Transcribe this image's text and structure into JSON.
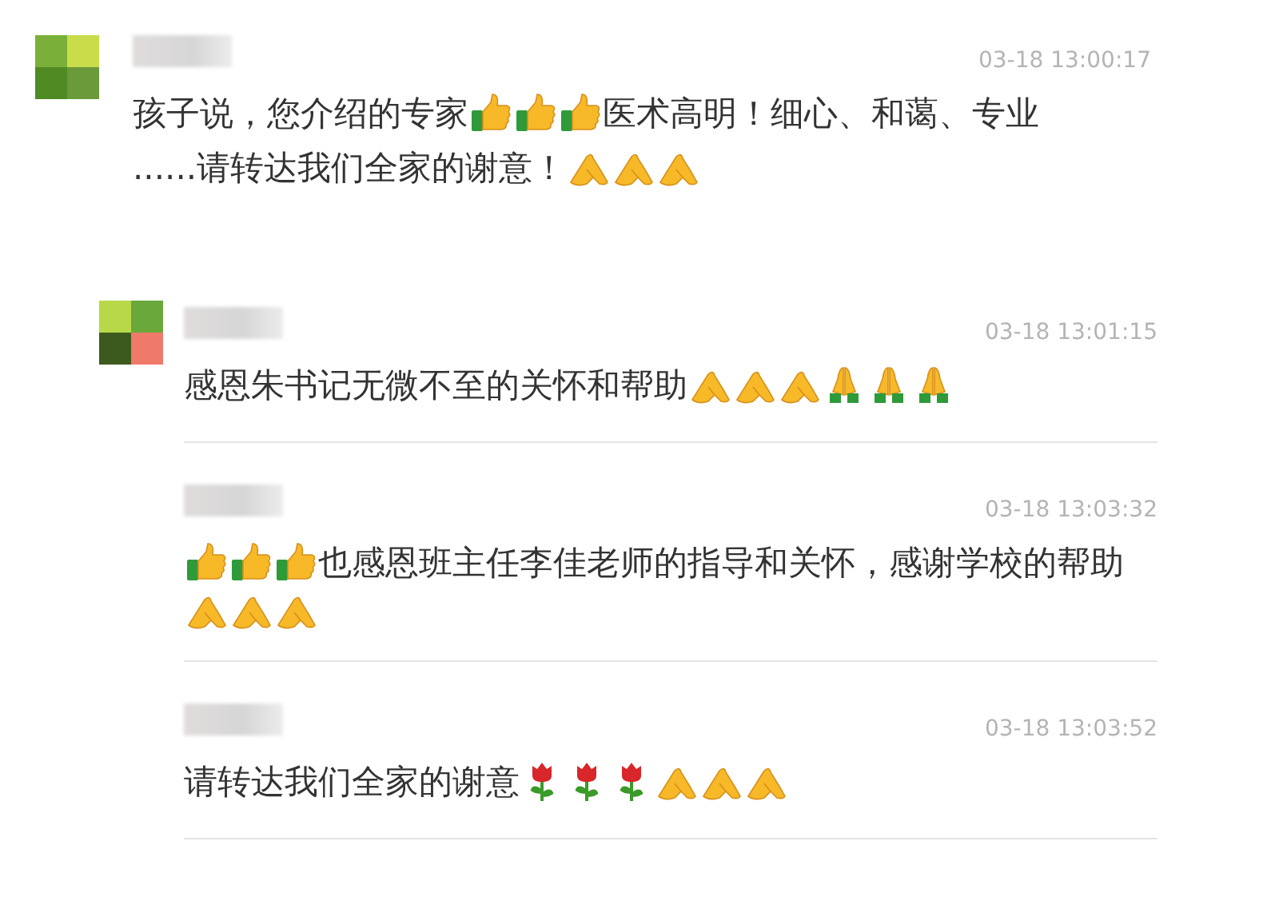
{
  "comment": {
    "time": "03-18 13:00:17",
    "has_avatar": true,
    "content": [
      {
        "kind": "text",
        "text": "孩子说，您介绍的专家"
      },
      {
        "kind": "thumbs-up"
      },
      {
        "kind": "thumbs-up"
      },
      {
        "kind": "thumbs-up"
      },
      {
        "kind": "text",
        "text": "医术高明！细心、和蔼、专业"
      },
      {
        "kind": "text",
        "text": "......请转达我们全家的谢意！"
      },
      {
        "kind": "palms"
      },
      {
        "kind": "palms"
      },
      {
        "kind": "palms"
      }
    ]
  },
  "replies": [
    {
      "time": "03-18 13:01:15",
      "has_avatar": true,
      "content": [
        {
          "kind": "text",
          "text": "感恩朱书记无微不至的关怀和帮助"
        },
        {
          "kind": "palms"
        },
        {
          "kind": "palms"
        },
        {
          "kind": "palms"
        },
        {
          "kind": "pray"
        },
        {
          "kind": "pray"
        },
        {
          "kind": "pray"
        }
      ]
    },
    {
      "time": "03-18 13:03:32",
      "has_avatar": false,
      "content": [
        {
          "kind": "thumbs-up"
        },
        {
          "kind": "thumbs-up"
        },
        {
          "kind": "thumbs-up"
        },
        {
          "kind": "text",
          "text": "也感恩班主任李佳老师的指导和关怀，感谢学校的帮"
        },
        {
          "kind": "text",
          "text": "助"
        },
        {
          "kind": "palms"
        },
        {
          "kind": "palms"
        },
        {
          "kind": "palms"
        }
      ]
    },
    {
      "time": "03-18 13:03:52",
      "has_avatar": false,
      "content": [
        {
          "kind": "text",
          "text": "请转达我们全家的谢意"
        },
        {
          "kind": "rose"
        },
        {
          "kind": "rose"
        },
        {
          "kind": "rose"
        },
        {
          "kind": "palms"
        },
        {
          "kind": "palms"
        },
        {
          "kind": "palms"
        }
      ]
    }
  ]
}
